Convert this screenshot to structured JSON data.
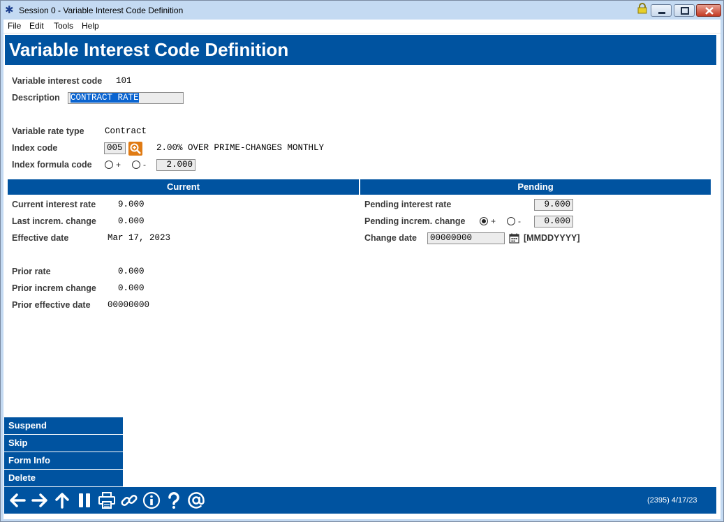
{
  "window": {
    "title": "Session 0  - Variable Interest Code Definition"
  },
  "menu": [
    "File",
    "Edit",
    "Tools",
    "Help"
  ],
  "page_title": "Variable Interest Code Definition",
  "form": {
    "variable_interest_code_label": "Variable interest code",
    "variable_interest_code_value": "101",
    "description_label": "Description",
    "description_value": "CONTRACT RATE",
    "variable_rate_type_label": "Variable rate type",
    "variable_rate_type_value": "Contract",
    "index_code_label": "Index code",
    "index_code_value": "005",
    "index_code_description": "2.00% OVER PRIME-CHANGES MONTHLY",
    "index_formula_code_label": "Index formula code",
    "index_formula_plus": "+",
    "index_formula_minus": "-",
    "index_formula_value": "2.000"
  },
  "sections": {
    "current": "Current",
    "pending": "Pending"
  },
  "current": {
    "current_interest_rate_label": "Current interest rate",
    "current_interest_rate_value": "9.000",
    "last_increm_change_label": "Last increm. change",
    "last_increm_change_value": "0.000",
    "effective_date_label": "Effective date",
    "effective_date_value": "Mar 17, 2023",
    "prior_rate_label": "Prior rate",
    "prior_rate_value": "0.000",
    "prior_increm_change_label": "Prior increm change",
    "prior_increm_change_value": "0.000",
    "prior_effective_date_label": "Prior effective date",
    "prior_effective_date_value": "00000000"
  },
  "pending": {
    "pending_interest_rate_label": "Pending interest rate",
    "pending_interest_rate_value": "9.000",
    "pending_increm_change_label": "Pending increm. change",
    "pending_plus": "+",
    "pending_minus": "-",
    "pending_increm_change_value": "0.000",
    "change_date_label": "Change date",
    "change_date_value": "00000000",
    "change_date_hint": "[MMDDYYYY]"
  },
  "side_buttons": [
    "Suspend",
    "Skip",
    "Form Info",
    "Delete"
  ],
  "toolbar_icons": [
    "back-arrow-icon",
    "forward-arrow-icon",
    "up-arrow-icon",
    "pause-icon",
    "print-icon",
    "link-icon",
    "info-icon",
    "help-icon",
    "at-icon"
  ],
  "status": "(2395) 4/17/23",
  "colors": {
    "brand_blue": "#0053a0",
    "lookup_orange": "#e07b14",
    "selection_blue": "#0a64d0"
  }
}
